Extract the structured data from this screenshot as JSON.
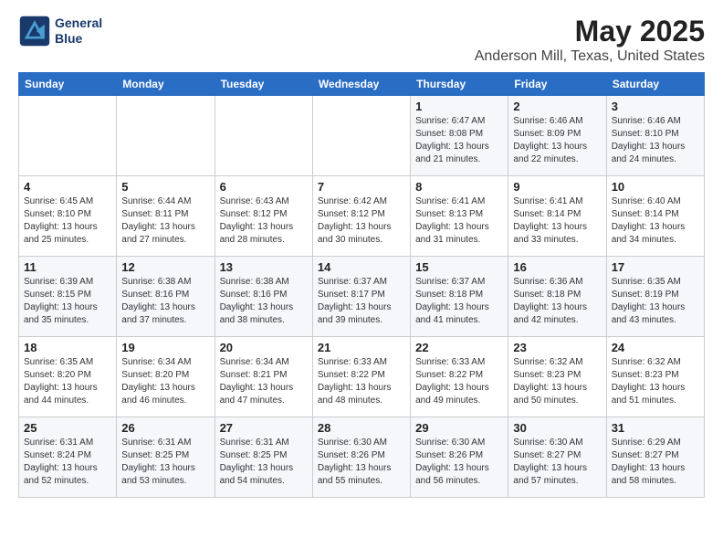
{
  "header": {
    "logo_line1": "General",
    "logo_line2": "Blue",
    "month": "May 2025",
    "location": "Anderson Mill, Texas, United States"
  },
  "days_of_week": [
    "Sunday",
    "Monday",
    "Tuesday",
    "Wednesday",
    "Thursday",
    "Friday",
    "Saturday"
  ],
  "weeks": [
    [
      {
        "day": "",
        "info": ""
      },
      {
        "day": "",
        "info": ""
      },
      {
        "day": "",
        "info": ""
      },
      {
        "day": "",
        "info": ""
      },
      {
        "day": "1",
        "info": "Sunrise: 6:47 AM\nSunset: 8:08 PM\nDaylight: 13 hours\nand 21 minutes."
      },
      {
        "day": "2",
        "info": "Sunrise: 6:46 AM\nSunset: 8:09 PM\nDaylight: 13 hours\nand 22 minutes."
      },
      {
        "day": "3",
        "info": "Sunrise: 6:46 AM\nSunset: 8:10 PM\nDaylight: 13 hours\nand 24 minutes."
      }
    ],
    [
      {
        "day": "4",
        "info": "Sunrise: 6:45 AM\nSunset: 8:10 PM\nDaylight: 13 hours\nand 25 minutes."
      },
      {
        "day": "5",
        "info": "Sunrise: 6:44 AM\nSunset: 8:11 PM\nDaylight: 13 hours\nand 27 minutes."
      },
      {
        "day": "6",
        "info": "Sunrise: 6:43 AM\nSunset: 8:12 PM\nDaylight: 13 hours\nand 28 minutes."
      },
      {
        "day": "7",
        "info": "Sunrise: 6:42 AM\nSunset: 8:12 PM\nDaylight: 13 hours\nand 30 minutes."
      },
      {
        "day": "8",
        "info": "Sunrise: 6:41 AM\nSunset: 8:13 PM\nDaylight: 13 hours\nand 31 minutes."
      },
      {
        "day": "9",
        "info": "Sunrise: 6:41 AM\nSunset: 8:14 PM\nDaylight: 13 hours\nand 33 minutes."
      },
      {
        "day": "10",
        "info": "Sunrise: 6:40 AM\nSunset: 8:14 PM\nDaylight: 13 hours\nand 34 minutes."
      }
    ],
    [
      {
        "day": "11",
        "info": "Sunrise: 6:39 AM\nSunset: 8:15 PM\nDaylight: 13 hours\nand 35 minutes."
      },
      {
        "day": "12",
        "info": "Sunrise: 6:38 AM\nSunset: 8:16 PM\nDaylight: 13 hours\nand 37 minutes."
      },
      {
        "day": "13",
        "info": "Sunrise: 6:38 AM\nSunset: 8:16 PM\nDaylight: 13 hours\nand 38 minutes."
      },
      {
        "day": "14",
        "info": "Sunrise: 6:37 AM\nSunset: 8:17 PM\nDaylight: 13 hours\nand 39 minutes."
      },
      {
        "day": "15",
        "info": "Sunrise: 6:37 AM\nSunset: 8:18 PM\nDaylight: 13 hours\nand 41 minutes."
      },
      {
        "day": "16",
        "info": "Sunrise: 6:36 AM\nSunset: 8:18 PM\nDaylight: 13 hours\nand 42 minutes."
      },
      {
        "day": "17",
        "info": "Sunrise: 6:35 AM\nSunset: 8:19 PM\nDaylight: 13 hours\nand 43 minutes."
      }
    ],
    [
      {
        "day": "18",
        "info": "Sunrise: 6:35 AM\nSunset: 8:20 PM\nDaylight: 13 hours\nand 44 minutes."
      },
      {
        "day": "19",
        "info": "Sunrise: 6:34 AM\nSunset: 8:20 PM\nDaylight: 13 hours\nand 46 minutes."
      },
      {
        "day": "20",
        "info": "Sunrise: 6:34 AM\nSunset: 8:21 PM\nDaylight: 13 hours\nand 47 minutes."
      },
      {
        "day": "21",
        "info": "Sunrise: 6:33 AM\nSunset: 8:22 PM\nDaylight: 13 hours\nand 48 minutes."
      },
      {
        "day": "22",
        "info": "Sunrise: 6:33 AM\nSunset: 8:22 PM\nDaylight: 13 hours\nand 49 minutes."
      },
      {
        "day": "23",
        "info": "Sunrise: 6:32 AM\nSunset: 8:23 PM\nDaylight: 13 hours\nand 50 minutes."
      },
      {
        "day": "24",
        "info": "Sunrise: 6:32 AM\nSunset: 8:23 PM\nDaylight: 13 hours\nand 51 minutes."
      }
    ],
    [
      {
        "day": "25",
        "info": "Sunrise: 6:31 AM\nSunset: 8:24 PM\nDaylight: 13 hours\nand 52 minutes."
      },
      {
        "day": "26",
        "info": "Sunrise: 6:31 AM\nSunset: 8:25 PM\nDaylight: 13 hours\nand 53 minutes."
      },
      {
        "day": "27",
        "info": "Sunrise: 6:31 AM\nSunset: 8:25 PM\nDaylight: 13 hours\nand 54 minutes."
      },
      {
        "day": "28",
        "info": "Sunrise: 6:30 AM\nSunset: 8:26 PM\nDaylight: 13 hours\nand 55 minutes."
      },
      {
        "day": "29",
        "info": "Sunrise: 6:30 AM\nSunset: 8:26 PM\nDaylight: 13 hours\nand 56 minutes."
      },
      {
        "day": "30",
        "info": "Sunrise: 6:30 AM\nSunset: 8:27 PM\nDaylight: 13 hours\nand 57 minutes."
      },
      {
        "day": "31",
        "info": "Sunrise: 6:29 AM\nSunset: 8:27 PM\nDaylight: 13 hours\nand 58 minutes."
      }
    ]
  ]
}
